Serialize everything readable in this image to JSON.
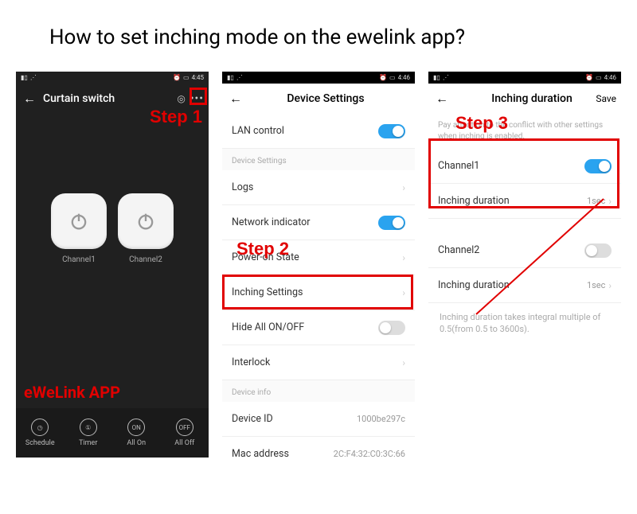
{
  "title": "How to set inching mode on the ewelink app?",
  "labels": {
    "step1": "Step 1",
    "step2": "Step 2",
    "step3": "Step 3",
    "app": "eWeLink APP"
  },
  "statusbar": {
    "time1": "4:45",
    "time2": "4:46",
    "time3": "4:46"
  },
  "phone1": {
    "title": "Curtain switch",
    "channel1": "Channel1",
    "channel2": "Channel2",
    "bottom": {
      "schedule": "Schedule",
      "timer": "Timer",
      "allon": "All On",
      "alloff": "All Off",
      "on_badge": "ON",
      "off_badge": "OFF"
    }
  },
  "phone2": {
    "title": "Device Settings",
    "rows": {
      "lan": "LAN control",
      "section_settings": "Device Settings",
      "logs": "Logs",
      "network": "Network indicator",
      "poweron": "Power-on State",
      "inching": "Inching Settings",
      "hideall": "Hide All ON/OFF",
      "interlock": "Interlock",
      "section_info": "Device info",
      "deviceid": "Device ID",
      "deviceid_val": "1000be297c",
      "mac": "Mac address",
      "mac_val": "2C:F4:32:C0:3C:66"
    }
  },
  "phone3": {
    "title": "Inching duration",
    "save": "Save",
    "hint": "Pay attention to the conflict with other settings when inching is enabled.",
    "channel1": "Channel1",
    "inching_duration": "Inching duration",
    "duration1": "1sec",
    "channel2": "Channel2",
    "duration2": "1sec",
    "footnote": "Inching duration takes integral multiple of 0.5(from 0.5 to 3600s)."
  }
}
